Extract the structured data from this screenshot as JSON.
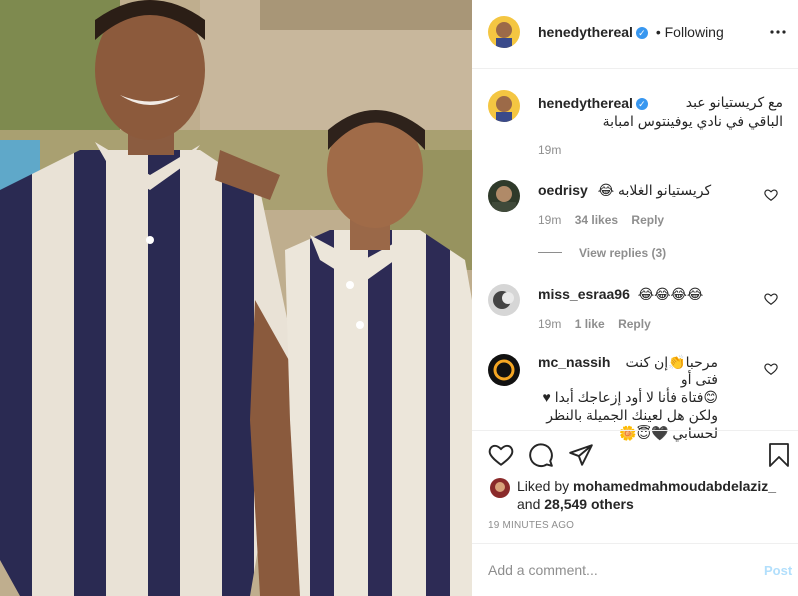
{
  "header": {
    "username": "henedythereal",
    "follow_status": "• Following",
    "more_icon": "more-horizontal-icon"
  },
  "caption": {
    "username": "henedythereal",
    "text_line1": "مع كريستيانو عبد",
    "text_line2": "الباقي في نادي يوفينتوس امبابة",
    "time": "19m"
  },
  "comments": [
    {
      "username": "oedrisy",
      "text": "كريستيانو الغلابه 😂",
      "time": "19m",
      "likes": "34 likes",
      "reply_label": "Reply",
      "view_replies": "View replies (3)"
    },
    {
      "username": "miss_esraa96",
      "text": "😂😂😂😂",
      "time": "19m",
      "likes": "1 like",
      "reply_label": "Reply"
    },
    {
      "username": "mc_nassih",
      "text_line1": "مرحبا👏إن كنت فتى أو",
      "text_line2": "😊فتاة فأنا لا أود إزعاجك أبدا ♥",
      "text_line3": "ولكن هل لعينك الجميلة بالنظر",
      "text_line4": "لحسابي 🖤😇🌼"
    }
  ],
  "actions": {
    "like_icon": "heart-icon",
    "comment_icon": "comment-icon",
    "share_icon": "share-icon",
    "save_icon": "bookmark-icon"
  },
  "likes": {
    "prefix": "Liked by",
    "liker": "mohamedmahmoudabdelaziz_",
    "and_text": "and",
    "others": "28,549 others"
  },
  "timestamp": "19 MINUTES AGO",
  "add_comment": {
    "placeholder": "Add a comment...",
    "post_label": "Post"
  },
  "colors": {
    "verified": "#3897f0",
    "post_disabled": "#b2dffc",
    "text": "#262626",
    "muted": "#8e8e8e"
  }
}
